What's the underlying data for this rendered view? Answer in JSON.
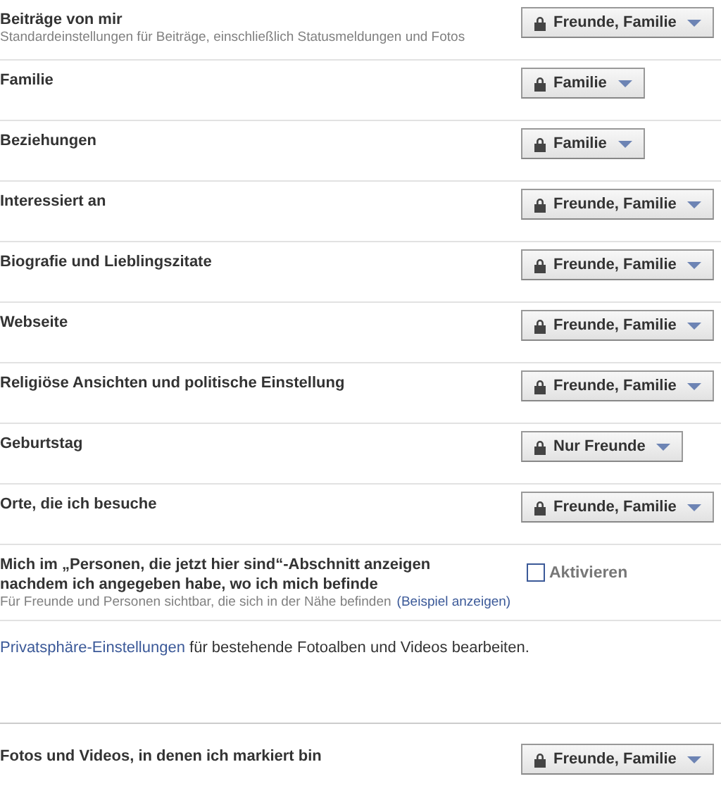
{
  "settings": [
    {
      "kind": "dropdown",
      "title": "Beiträge von mir",
      "subtitle": "Standardeinstellungen für Beiträge, einschließlich Statusmeldungen und Fotos",
      "value": "Freunde, Familie"
    },
    {
      "kind": "dropdown",
      "title": "Familie",
      "value": "Familie"
    },
    {
      "kind": "dropdown",
      "title": "Beziehungen",
      "value": "Familie"
    },
    {
      "kind": "dropdown",
      "title": "Interessiert an",
      "value": "Freunde, Familie"
    },
    {
      "kind": "dropdown",
      "title": "Biografie und Lieblingszitate",
      "value": "Freunde, Familie"
    },
    {
      "kind": "dropdown",
      "title": "Webseite",
      "value": "Freunde, Familie"
    },
    {
      "kind": "dropdown",
      "title": "Religiöse Ansichten und politische Einstellung",
      "value": "Freunde, Familie"
    },
    {
      "kind": "dropdown",
      "title": "Geburtstag",
      "value": "Nur Freunde"
    },
    {
      "kind": "dropdown",
      "title": "Orte, die ich besuche",
      "value": "Freunde, Familie"
    },
    {
      "kind": "checkbox",
      "title": "Mich im „Personen, die jetzt hier sind“-Abschnitt anzeigen nachdem ich angegeben habe, wo ich mich befinde",
      "subtitle": "Für Freunde und Personen sichtbar, die sich in der Nähe befinden",
      "subtitle_link": "(Beispiel anzeigen)",
      "label": "Aktivieren",
      "checked": false
    }
  ],
  "photo_note": {
    "link": "Privatsphäre-Einstellungen",
    "text": "für bestehende Fotoalben und Videos bearbeiten."
  },
  "tagged_settings": [
    {
      "kind": "dropdown",
      "title": "Fotos und Videos, in denen ich markiert bin",
      "value": "Freunde, Familie"
    }
  ]
}
